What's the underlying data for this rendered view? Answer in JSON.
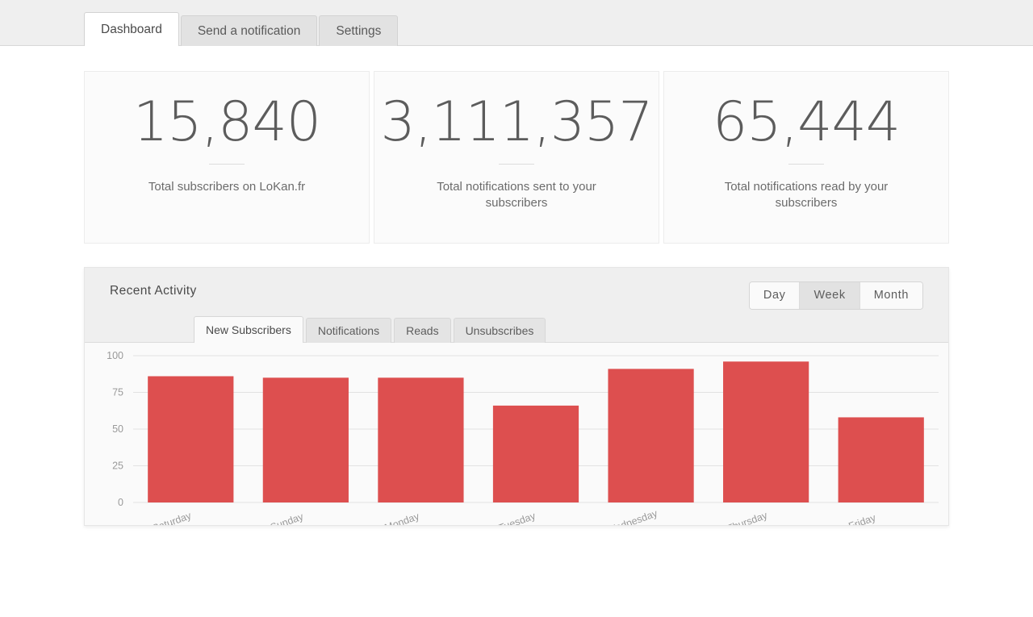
{
  "app": {
    "tabs": [
      {
        "label": "Dashboard",
        "active": true
      },
      {
        "label": "Send a notification",
        "active": false
      },
      {
        "label": "Settings",
        "active": false
      }
    ]
  },
  "stats": [
    {
      "value": "15,840",
      "label": "Total subscribers on LoKan.fr"
    },
    {
      "value": "3,111,357",
      "label": "Total notifications sent to your subscribers"
    },
    {
      "value": "65,444",
      "label": "Total notifications read by your subscribers"
    }
  ],
  "activity": {
    "title": "Recent Activity",
    "range_options": [
      {
        "label": "Day",
        "active": false
      },
      {
        "label": "Week",
        "active": true
      },
      {
        "label": "Month",
        "active": false
      }
    ],
    "tabs": [
      {
        "label": "New Subscribers",
        "active": true
      },
      {
        "label": "Notifications",
        "active": false
      },
      {
        "label": "Reads",
        "active": false
      },
      {
        "label": "Unsubscribes",
        "active": false
      }
    ]
  },
  "chart_data": {
    "type": "bar",
    "title": "Recent Activity",
    "series_name": "New Subscribers",
    "categories": [
      "Saturday",
      "Sunday",
      "Monday",
      "Tuesday",
      "Wednesday",
      "Thursday",
      "Friday"
    ],
    "values": [
      86,
      85,
      85,
      66,
      91,
      96,
      58
    ],
    "xlabel": "",
    "ylabel": "",
    "ylim": [
      0,
      100
    ],
    "yticks": [
      0,
      25,
      50,
      75,
      100
    ],
    "ytick_labels": [
      "0",
      "25",
      "50",
      "75",
      "100"
    ],
    "grid": true,
    "legend": false,
    "bar_color": "#dd4f4f",
    "gridline_color": "#e2e2e2",
    "axis_text_color": "#9a9a9a",
    "xtick_rotation": -20
  },
  "colors": {
    "accent": "#dd4f4f",
    "topbar_bg": "#efefef",
    "panel_bg": "#fafafa",
    "card_bg": "#fbfbfb",
    "text": "#5a5a5a"
  }
}
